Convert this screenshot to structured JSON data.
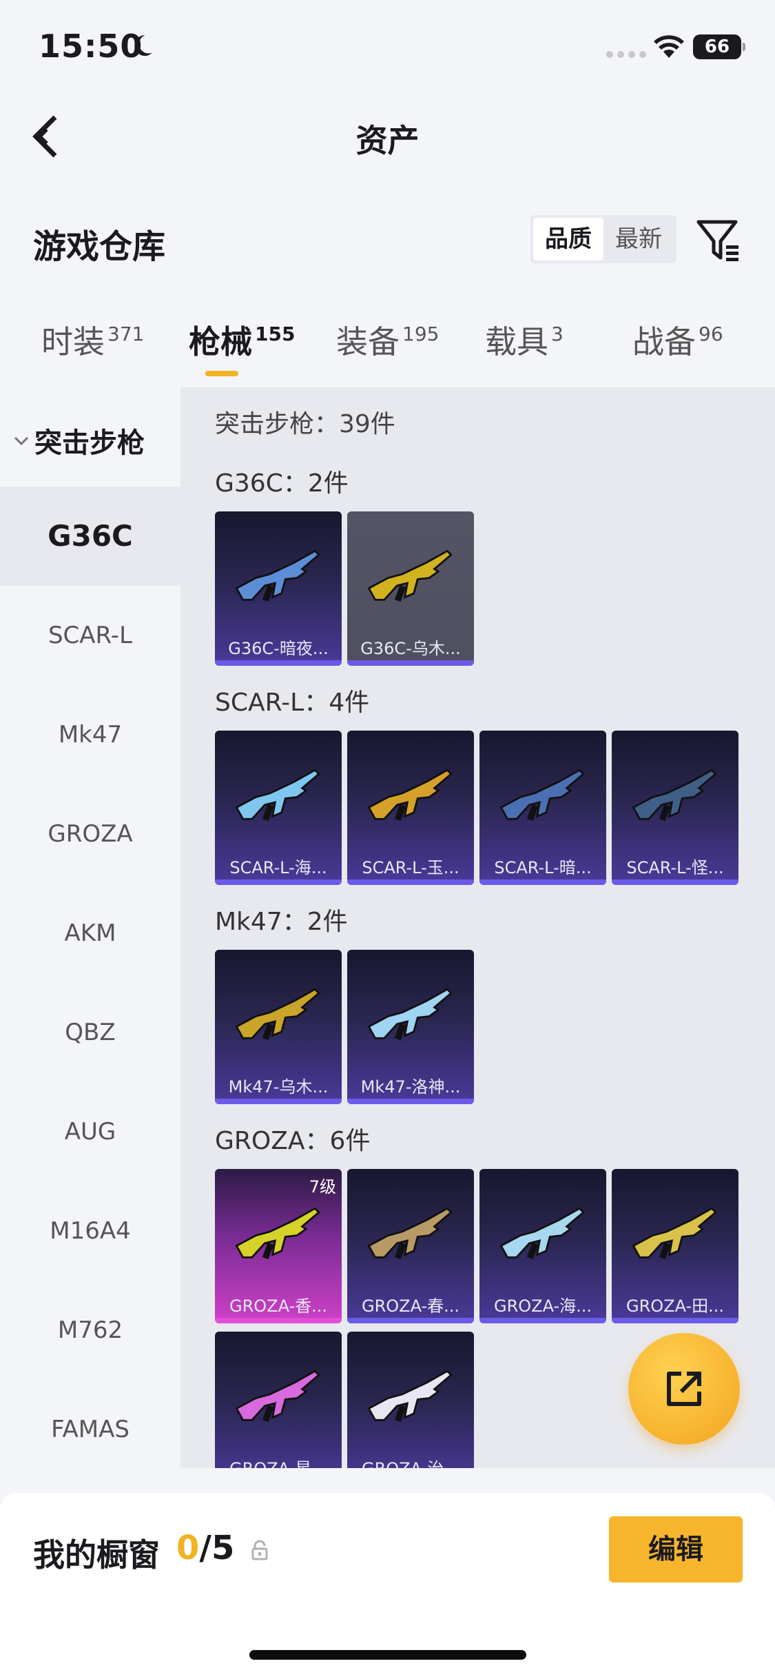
{
  "status": {
    "time": "15:50",
    "battery": "66"
  },
  "nav": {
    "title": "资产"
  },
  "header": {
    "title": "游戏仓库",
    "sort_options": [
      "品质",
      "最新"
    ],
    "sort_active": "品质"
  },
  "tabs": [
    {
      "label": "时装",
      "count": "371"
    },
    {
      "label": "枪械",
      "count": "155"
    },
    {
      "label": "装备",
      "count": "195"
    },
    {
      "label": "载具",
      "count": "3"
    },
    {
      "label": "战备",
      "count": "96"
    }
  ],
  "sidebar": {
    "category": "突击步枪",
    "items": [
      "G36C",
      "SCAR-L",
      "Mk47",
      "GROZA",
      "AKM",
      "QBZ",
      "AUG",
      "M16A4",
      "M762",
      "FAMAS"
    ]
  },
  "main": {
    "total": "突击步枪：39件",
    "groups": [
      {
        "label": "G36C：2件",
        "items": [
          {
            "name": "G36C-暗夜...",
            "style": "purple",
            "gun": "#5b8ed6"
          },
          {
            "name": "G36C-乌木...",
            "style": "gray",
            "gun": "#d2b21e"
          }
        ]
      },
      {
        "label": "SCAR-L：4件",
        "items": [
          {
            "name": "SCAR-L-海...",
            "style": "purple",
            "gun": "#7fc7f0"
          },
          {
            "name": "SCAR-L-玉...",
            "style": "purple",
            "gun": "#d6a12a"
          },
          {
            "name": "SCAR-L-暗...",
            "style": "purple",
            "gun": "#4b6fb3"
          },
          {
            "name": "SCAR-L-怪...",
            "style": "purple",
            "gun": "#3f5f86"
          }
        ]
      },
      {
        "label": "Mk47：2件",
        "items": [
          {
            "name": "Mk47-乌木...",
            "style": "purple",
            "gun": "#c9a52a"
          },
          {
            "name": "Mk47-洛神...",
            "style": "purple",
            "gun": "#9fd4f2"
          }
        ]
      },
      {
        "label": "GROZA：6件",
        "items": [
          {
            "name": "GROZA-香...",
            "style": "pink",
            "gun": "#d7d22a",
            "level": "7级"
          },
          {
            "name": "GROZA-春...",
            "style": "purple",
            "gun": "#b89a66"
          },
          {
            "name": "GROZA-海...",
            "style": "purple",
            "gun": "#a7d8f0"
          },
          {
            "name": "GROZA-田...",
            "style": "purple",
            "gun": "#d9c24a"
          },
          {
            "name": "GROZA-星...",
            "style": "purple",
            "gun": "#d86adf"
          },
          {
            "name": "GROZA-治...",
            "style": "purple",
            "gun": "#e7e7f2"
          }
        ]
      }
    ]
  },
  "bottom": {
    "label": "我的橱窗",
    "count_current": "0",
    "count_total": "/5",
    "edit_label": "编辑"
  },
  "colors": {
    "accent": "#f0b323",
    "card_purple": "#4a3a9a",
    "card_pink": "#cf41c8"
  },
  "icons": {
    "back": "chevron-left-icon",
    "filter": "filter-icon",
    "fab": "share-external-icon",
    "lock": "lock-icon"
  }
}
